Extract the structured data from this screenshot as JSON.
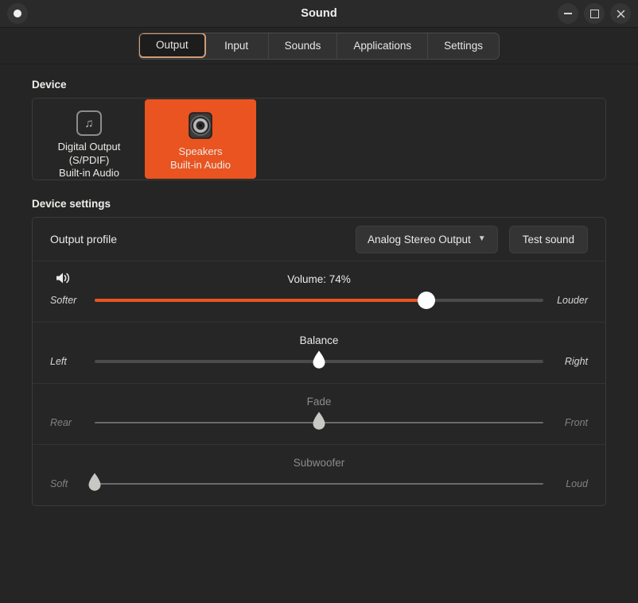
{
  "window": {
    "title": "Sound",
    "left_button": "record-dot",
    "controls": {
      "minimize": "−",
      "maximize": "□",
      "close": "✕"
    }
  },
  "tabs": [
    {
      "label": "Output",
      "active": true
    },
    {
      "label": "Input",
      "active": false
    },
    {
      "label": "Sounds",
      "active": false
    },
    {
      "label": "Applications",
      "active": false
    },
    {
      "label": "Settings",
      "active": false
    }
  ],
  "device_section": {
    "heading": "Device",
    "cards": [
      {
        "icon": "music-note-icon",
        "title": "Digital Output (S/PDIF)",
        "subtitle": "Built-in Audio",
        "selected": false
      },
      {
        "icon": "speaker-icon",
        "title": "Speakers",
        "subtitle": "Built-in Audio",
        "selected": true
      }
    ]
  },
  "device_settings": {
    "heading": "Device settings",
    "profile": {
      "label": "Output profile",
      "selected_option": "Analog Stereo Output",
      "test_button": "Test sound"
    },
    "sliders": [
      {
        "name": "volume",
        "title": "Volume: 74%",
        "left_label": "Softer",
        "right_label": "Louder",
        "value_percent": 74,
        "enabled": true,
        "has_fill": true,
        "handle": "round",
        "icon": "volume-icon"
      },
      {
        "name": "balance",
        "title": "Balance",
        "left_label": "Left",
        "right_label": "Right",
        "value_percent": 50,
        "enabled": true,
        "has_fill": false,
        "handle": "teardrop"
      },
      {
        "name": "fade",
        "title": "Fade",
        "left_label": "Rear",
        "right_label": "Front",
        "value_percent": 50,
        "enabled": false,
        "has_fill": false,
        "handle": "teardrop"
      },
      {
        "name": "subwoofer",
        "title": "Subwoofer",
        "left_label": "Soft",
        "right_label": "Loud",
        "value_percent": 0,
        "enabled": false,
        "has_fill": false,
        "handle": "teardrop"
      }
    ]
  },
  "colors": {
    "accent": "#e95420",
    "window_bg": "#252525",
    "panel_bg": "#262626",
    "active_tab_border": "#d29a75"
  }
}
